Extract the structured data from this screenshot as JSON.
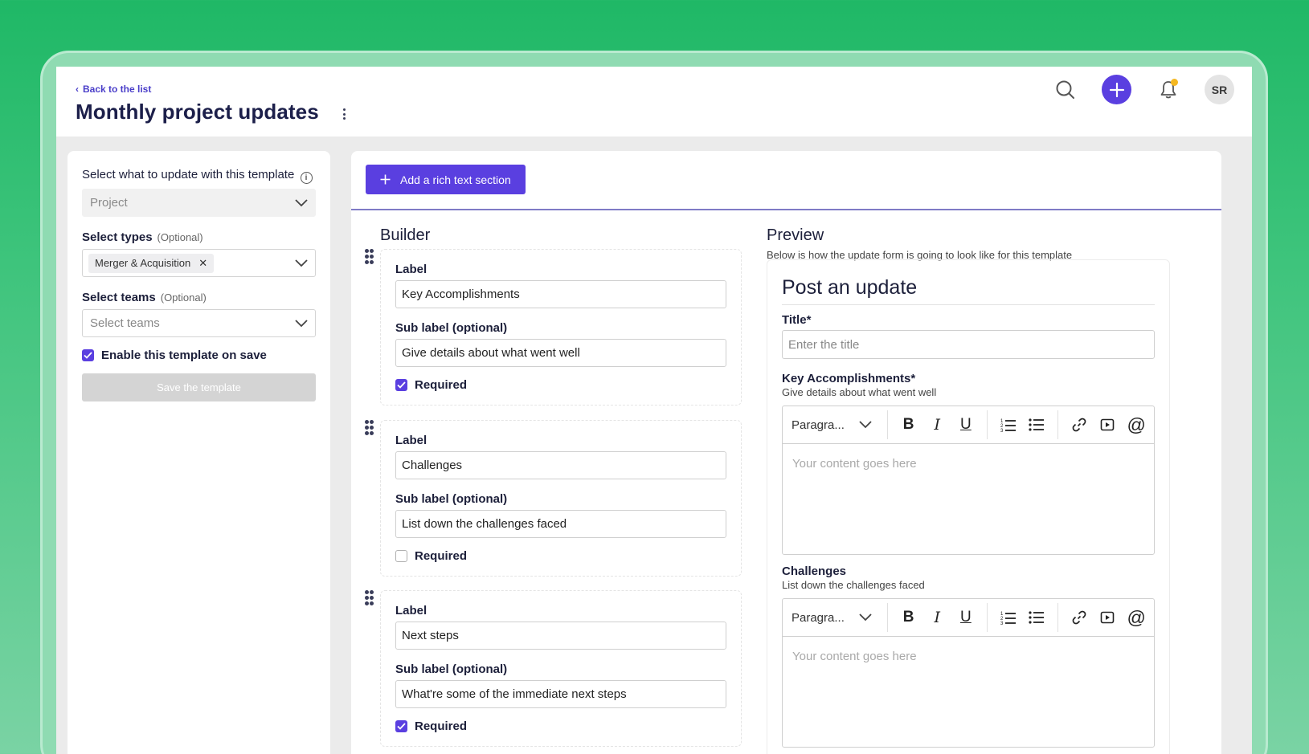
{
  "header": {
    "back_label": "Back to the list",
    "title": "Monthly project updates",
    "avatar_initials": "SR",
    "accent_color": "#5a3fe0",
    "notification_dot_color": "#f5b821"
  },
  "left_panel": {
    "select_what_label": "Select what to update with this template",
    "select_what_value": "Project",
    "types_label": "Select types",
    "types_optional": "(Optional)",
    "types_chip": "Merger & Acquisition",
    "teams_label": "Select teams",
    "teams_optional": "(Optional)",
    "teams_placeholder": "Select teams",
    "enable_label": "Enable this template on save",
    "enable_checked": true,
    "save_button": "Save the template"
  },
  "main": {
    "add_section_button": "Add a rich text section",
    "builder_title": "Builder",
    "preview_title": "Preview",
    "preview_subtitle": "Below is how the update form is going to look like for this template"
  },
  "builder": {
    "label_text": "Label",
    "sublabel_text": "Sub label (optional)",
    "required_text": "Required",
    "fields": [
      {
        "label": "Key Accomplishments",
        "sublabel": "Give details about what went well",
        "required": true
      },
      {
        "label": "Challenges",
        "sublabel": "List down the challenges faced",
        "required": false
      },
      {
        "label": "Next steps",
        "sublabel": "What're some of the immediate next steps",
        "required": true
      }
    ]
  },
  "preview": {
    "post_title": "Post an update",
    "title_label": "Title*",
    "title_placeholder": "Enter the title",
    "sections": [
      {
        "label": "Key Accomplishments*",
        "sublabel": "Give details about what went well"
      },
      {
        "label": "Challenges",
        "sublabel": "List down the challenges faced"
      }
    ],
    "editor": {
      "paragraph_select": "Paragra...",
      "placeholder": "Your content goes here"
    }
  }
}
